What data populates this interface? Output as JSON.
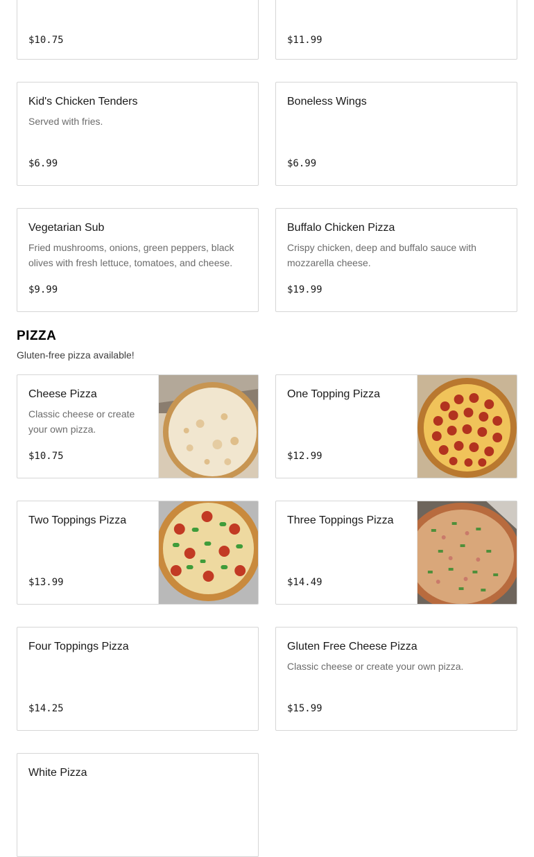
{
  "top_items": [
    {
      "price": "$10.75"
    },
    {
      "price": "$11.99"
    }
  ],
  "items": [
    {
      "name": "Kid's Chicken Tenders",
      "description": "Served with fries.",
      "price": "$6.99"
    },
    {
      "name": "Boneless Wings",
      "description": "",
      "price": "$6.99"
    },
    {
      "name": "Vegetarian Sub",
      "description": "Fried mushrooms, onions, green peppers, black olives with fresh lettuce, tomatoes, and cheese.",
      "price": "$9.99"
    },
    {
      "name": "Buffalo Chicken Pizza",
      "description": "Crispy chicken, deep and buffalo sauce with mozzarella cheese.",
      "price": "$19.99"
    }
  ],
  "pizza_section": {
    "title": "PIZZA",
    "subtitle": "Gluten-free pizza available!",
    "items": [
      {
        "name": "Cheese Pizza",
        "description": "Classic cheese or create your own pizza.",
        "price": "$10.75",
        "image": "cheese-pizza-photo"
      },
      {
        "name": "One Topping Pizza",
        "description": "",
        "price": "$12.99",
        "image": "pepperoni-pizza-photo"
      },
      {
        "name": "Two Toppings Pizza",
        "description": "",
        "price": "$13.99",
        "image": "pepper-pizza-photo"
      },
      {
        "name": "Three Toppings Pizza",
        "description": "",
        "price": "$14.49",
        "image": "three-topping-pizza-photo"
      },
      {
        "name": "Four Toppings Pizza",
        "description": "",
        "price": "$14.25"
      },
      {
        "name": "Gluten Free Cheese Pizza",
        "description": "Classic cheese or create your own pizza.",
        "price": "$15.99"
      },
      {
        "name": "White Pizza",
        "description": "",
        "price": ""
      }
    ]
  }
}
